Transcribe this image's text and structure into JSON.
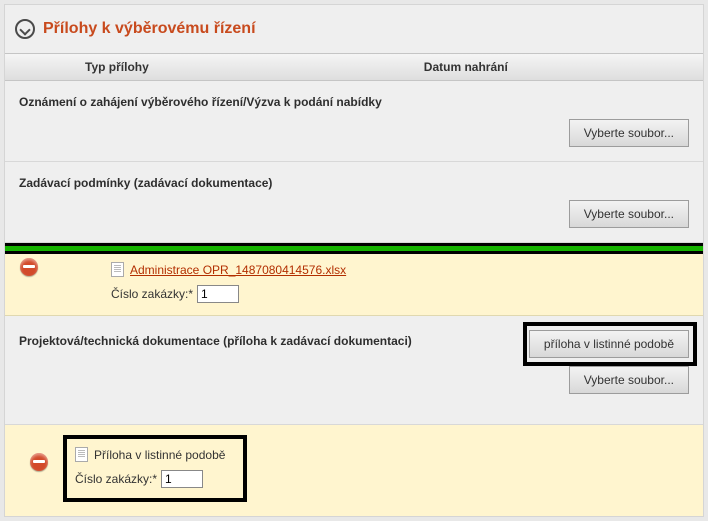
{
  "section": {
    "title": "Přílohy k výběrovému řízení"
  },
  "columns": {
    "type": "Typ přílohy",
    "date": "Datum nahrání"
  },
  "rows": {
    "r1": {
      "title": "Oznámení o zahájení výběrového řízení/Výzva k podání nabídky"
    },
    "r2": {
      "title": "Zadávací podmínky (zadávací dokumentace)"
    },
    "r3": {
      "title": "Projektová/technická dokumentace (příloha k zadávací dokumentaci)"
    }
  },
  "buttons": {
    "select_file": "Vyberte soubor...",
    "paper_attachment": "příloha v listinné podobě"
  },
  "file1": {
    "link": "Administrace OPR_1487080414576.xlsx",
    "order_label": "Číslo zakázky:*",
    "order_value": "1"
  },
  "file2": {
    "text": "Příloha v listinné podobě",
    "order_label": "Číslo zakázky:*",
    "order_value": "1"
  }
}
